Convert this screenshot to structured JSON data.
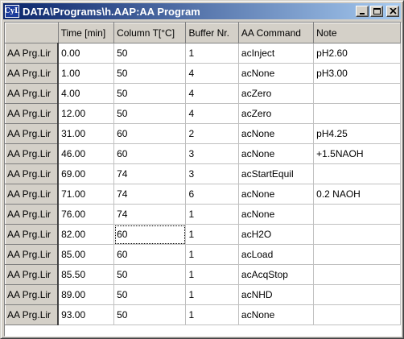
{
  "window": {
    "icon_text": "CyL",
    "title": "DATA\\Programs\\h.AAP:AA Program"
  },
  "grid": {
    "columns": [
      "",
      "Time [min]",
      "Column T[°C]",
      "Buffer Nr.",
      "AA Command",
      "Note"
    ],
    "row_label": "AA Prg.Lir",
    "rows": [
      {
        "time": "0.00",
        "temp": "50",
        "buffer": "1",
        "command": "acInject",
        "note": "pH2.60"
      },
      {
        "time": "1.00",
        "temp": "50",
        "buffer": "4",
        "command": "acNone",
        "note": "pH3.00"
      },
      {
        "time": "4.00",
        "temp": "50",
        "buffer": "4",
        "command": "acZero",
        "note": ""
      },
      {
        "time": "12.00",
        "temp": "50",
        "buffer": "4",
        "command": "acZero",
        "note": ""
      },
      {
        "time": "31.00",
        "temp": "60",
        "buffer": "2",
        "command": "acNone",
        "note": "pH4.25"
      },
      {
        "time": "46.00",
        "temp": "60",
        "buffer": "3",
        "command": "acNone",
        "note": "+1.5NAOH"
      },
      {
        "time": "69.00",
        "temp": "74",
        "buffer": "3",
        "command": "acStartEquil",
        "note": ""
      },
      {
        "time": "71.00",
        "temp": "74",
        "buffer": "6",
        "command": "acNone",
        "note": "0.2 NAOH"
      },
      {
        "time": "76.00",
        "temp": "74",
        "buffer": "1",
        "command": "acNone",
        "note": ""
      },
      {
        "time": "82.00",
        "temp": "60",
        "buffer": "1",
        "command": "acH2O",
        "note": ""
      },
      {
        "time": "85.00",
        "temp": "60",
        "buffer": "1",
        "command": "acLoad",
        "note": ""
      },
      {
        "time": "85.50",
        "temp": "50",
        "buffer": "1",
        "command": "acAcqStop",
        "note": ""
      },
      {
        "time": "89.00",
        "temp": "50",
        "buffer": "1",
        "command": "acNHD",
        "note": ""
      },
      {
        "time": "93.00",
        "temp": "50",
        "buffer": "1",
        "command": "acNone",
        "note": ""
      }
    ]
  }
}
